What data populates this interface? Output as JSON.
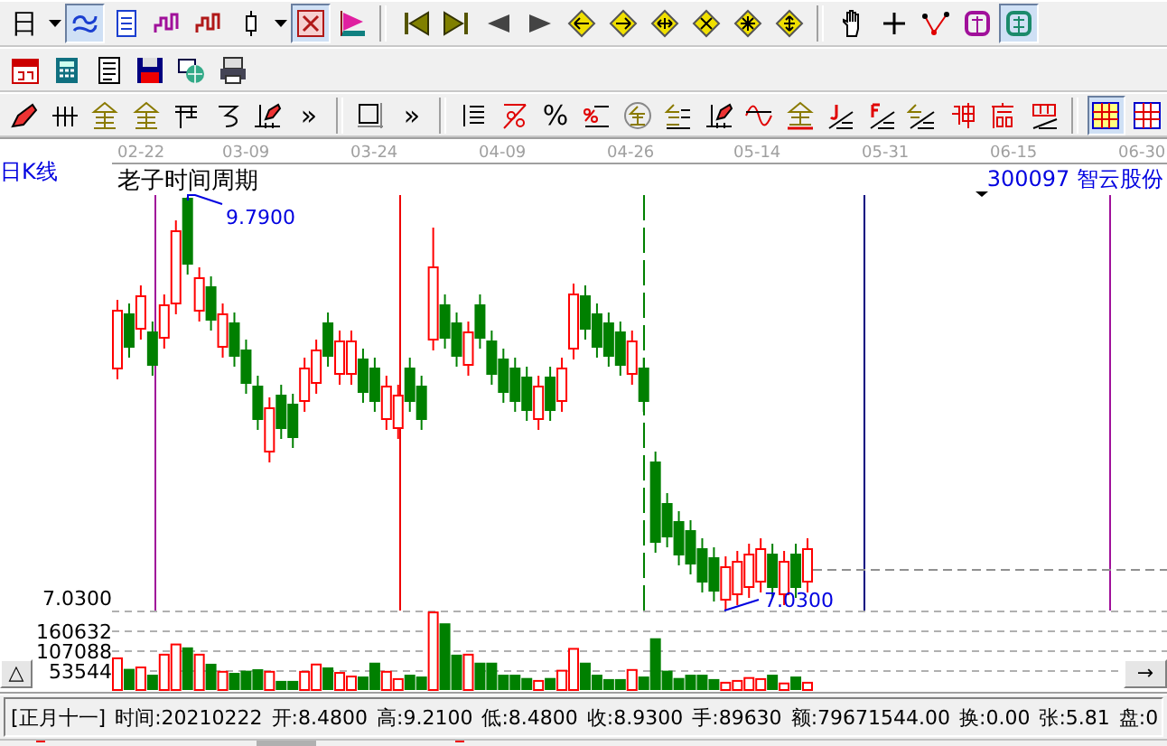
{
  "toolbars": [
    {
      "buttons": [
        {
          "kind": "text",
          "label": "日",
          "selected": false
        },
        {
          "kind": "caret",
          "selected": false
        },
        {
          "kind": "swirl",
          "selected": true
        },
        {
          "kind": "document",
          "selected": false
        },
        {
          "kind": "step-wave",
          "selected": false
        },
        {
          "kind": "step-wave-alt",
          "selected": false
        },
        {
          "kind": "candle",
          "selected": false
        },
        {
          "kind": "caret",
          "selected": false
        },
        {
          "kind": "cross-grid",
          "selected": true
        },
        {
          "kind": "flag",
          "selected": false
        },
        {
          "kind": "separator"
        },
        {
          "kind": "skip-first",
          "selected": false
        },
        {
          "kind": "skip-last",
          "selected": false
        },
        {
          "kind": "triangle-left",
          "selected": false
        },
        {
          "kind": "triangle-right",
          "selected": false
        },
        {
          "kind": "diamond-left",
          "selected": false
        },
        {
          "kind": "diamond-right",
          "selected": false
        },
        {
          "kind": "diamond-both",
          "selected": false
        },
        {
          "kind": "diamond-shrink",
          "selected": false
        },
        {
          "kind": "diamond-expand",
          "selected": false
        },
        {
          "kind": "diamond-vertical",
          "selected": false
        },
        {
          "kind": "separator"
        },
        {
          "kind": "hand",
          "selected": false
        },
        {
          "kind": "crosshair",
          "selected": false
        },
        {
          "kind": "polyline",
          "selected": false
        },
        {
          "kind": "square-glyph",
          "selected": false
        },
        {
          "kind": "grid-glyph",
          "selected": true
        }
      ]
    },
    {
      "buttons": [
        {
          "kind": "calendar",
          "selected": false
        },
        {
          "kind": "calculator",
          "selected": false
        },
        {
          "kind": "notes",
          "selected": false
        },
        {
          "kind": "floppy",
          "selected": false
        },
        {
          "kind": "globe",
          "selected": false
        },
        {
          "kind": "printer",
          "selected": false
        }
      ]
    },
    {
      "buttons": [
        {
          "kind": "pen",
          "selected": false
        },
        {
          "kind": "hash",
          "selected": false
        },
        {
          "kind": "roof-glyph",
          "selected": false
        },
        {
          "kind": "roof-glyph",
          "selected": false
        },
        {
          "kind": "ladder",
          "selected": false
        },
        {
          "kind": "spiral",
          "selected": false
        },
        {
          "kind": "pen-ruler",
          "selected": false
        },
        {
          "kind": "text",
          "label": "»",
          "selected": false
        },
        {
          "kind": "separator"
        },
        {
          "kind": "frame",
          "selected": false
        },
        {
          "kind": "text",
          "label": "»",
          "selected": false
        },
        {
          "kind": "separator"
        },
        {
          "kind": "list",
          "selected": false
        },
        {
          "kind": "percent-line",
          "selected": false
        },
        {
          "kind": "text",
          "label": "%",
          "selected": false
        },
        {
          "kind": "percent-lines",
          "selected": false
        },
        {
          "kind": "coin",
          "selected": false
        },
        {
          "kind": "glyph-lines",
          "selected": false
        },
        {
          "kind": "pen-ruler",
          "selected": false
        },
        {
          "kind": "wave-cross",
          "selected": false
        },
        {
          "kind": "glyph-underline",
          "selected": false
        },
        {
          "kind": "hook-fan",
          "selected": false
        },
        {
          "kind": "f-fan",
          "selected": false
        },
        {
          "kind": "glyph-fan",
          "selected": false
        },
        {
          "kind": "block-glyph",
          "selected": false
        },
        {
          "kind": "tower-glyph",
          "selected": false
        },
        {
          "kind": "window-fan",
          "selected": false
        },
        {
          "kind": "separator"
        },
        {
          "kind": "grid-fill",
          "selected": true
        },
        {
          "kind": "grid-plain",
          "selected": false
        }
      ]
    }
  ],
  "chart": {
    "period_label": "日K线",
    "dates": [
      "02-22",
      "03-09",
      "03-24",
      "04-09",
      "04-26",
      "05-14",
      "05-31",
      "06-15",
      "06-30"
    ],
    "title": "老子时间周期",
    "stock": "300097 智云股份",
    "price_axis_label": "7.0300",
    "high_label": "9.7900",
    "low_label": "7.0300",
    "volume_axis_labels": [
      "160632",
      "107088",
      "53544"
    ],
    "scroll_left": "△",
    "scroll_right": "→"
  },
  "status_bar": {
    "fields": [
      "[正月十一]",
      "时间:20210222",
      "开:8.4800",
      "高:9.2100",
      "低:8.4800",
      "收:8.9300",
      "手:89630",
      "额:79671544.00",
      "换:0.00",
      "张:5.81",
      "盘:0"
    ]
  }
}
